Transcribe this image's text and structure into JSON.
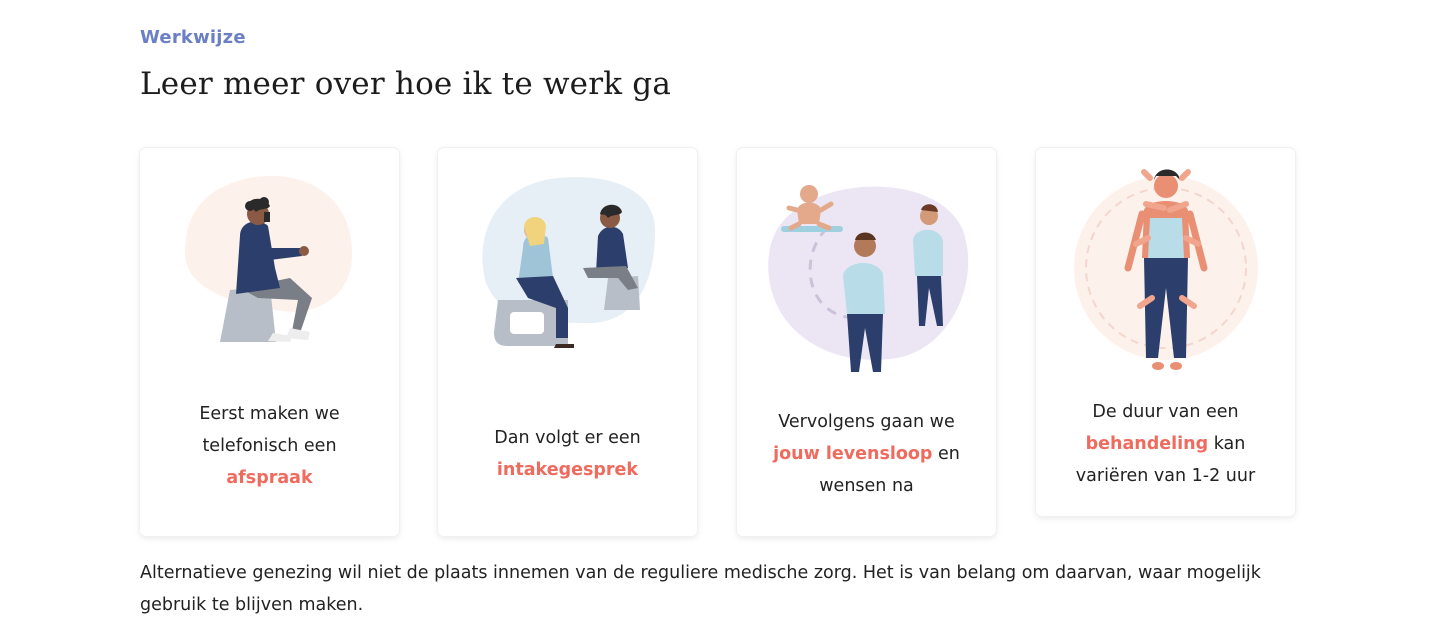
{
  "section": {
    "eyebrow": "Werkwijze",
    "title": "Leer meer over hoe ik te werk ga"
  },
  "steps": [
    {
      "illustration": "man-on-phone-illustration",
      "before": "Eerst maken we telefonisch een ",
      "highlight": "afspraak",
      "after": ""
    },
    {
      "illustration": "intake-conversation-illustration",
      "before": "Dan volgt er een ",
      "highlight": "intakegesprek",
      "after": ""
    },
    {
      "illustration": "life-course-illustration",
      "before": "Vervolgens gaan we ",
      "highlight": "jouw levensloop",
      "after": " en wensen na"
    },
    {
      "illustration": "treatment-hands-illustration",
      "before": "De duur van een ",
      "highlight": "behandeling",
      "after": " kan variëren van 1-2 uur"
    }
  ],
  "intro_text": "Alternatieve genezing wil niet de plaats innemen van de reguliere medische zorg. Het is van belang om daarvan, waar mogelijk gebruik te blijven maken.",
  "colors": {
    "eyebrow": "#6b7fc4",
    "highlight": "#ee6b5e",
    "navy": "#2c3e6b",
    "skin": "#c98a6a"
  }
}
